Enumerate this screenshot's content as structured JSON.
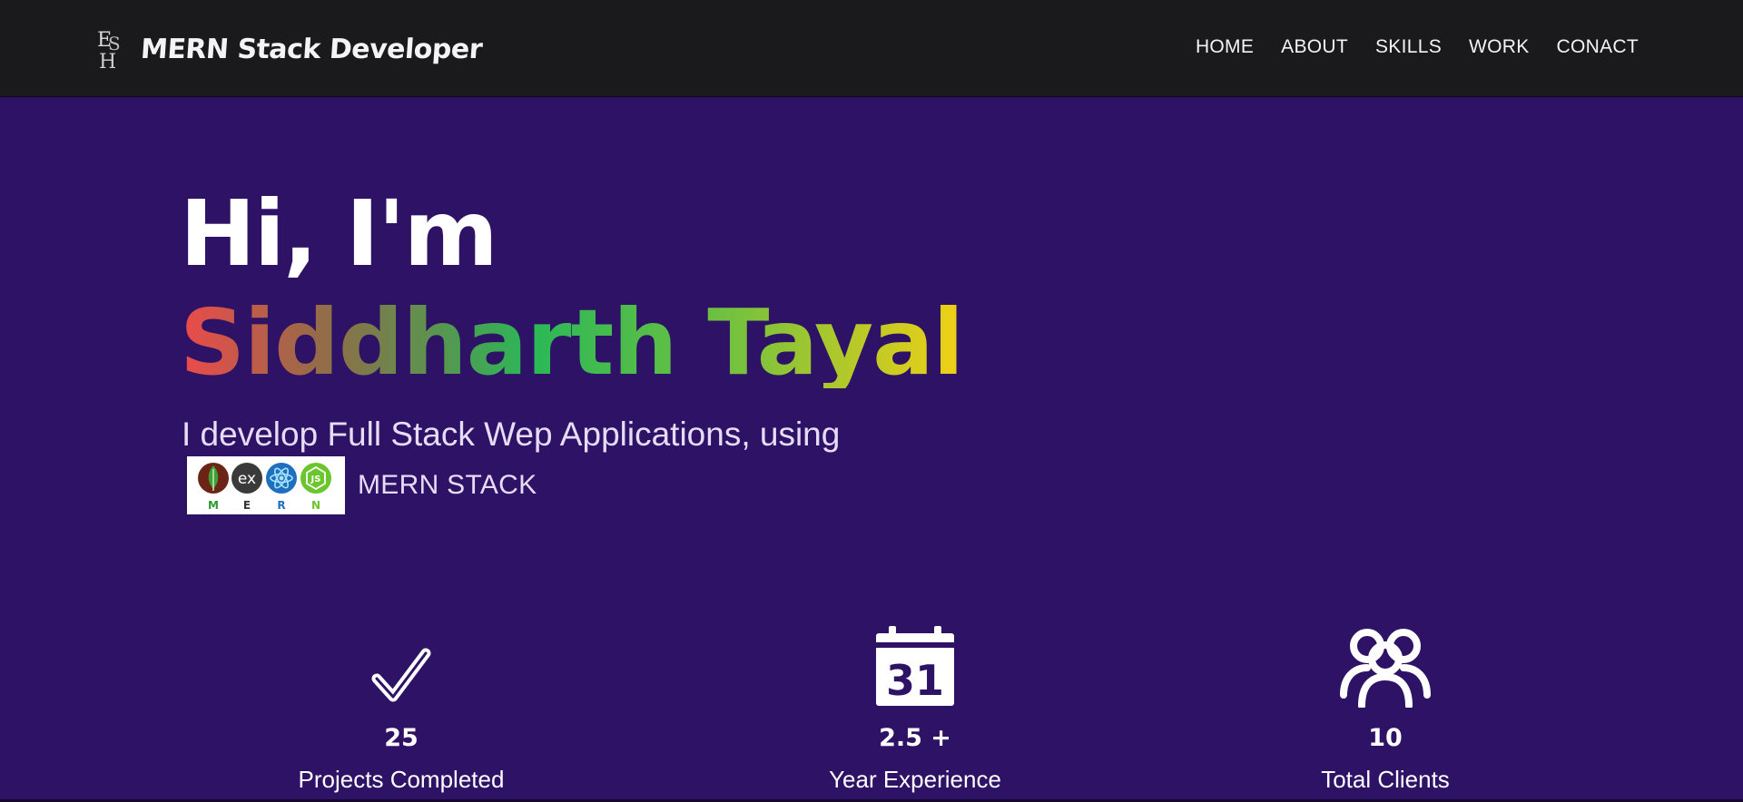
{
  "header": {
    "brand_title": "MERN Stack Developer",
    "nav": [
      "HOME",
      "ABOUT",
      "SKILLS",
      "WORK",
      "CONACT"
    ]
  },
  "hero": {
    "greeting": "Hi, I'm",
    "name": "Siddharth Tayal",
    "tagline": "I develop Full Stack Wep Applications, using",
    "stack_label": "MERN STACK",
    "stack_logo_letters": [
      "M",
      "E",
      "R",
      "N"
    ],
    "stack_logo_badges": [
      "mongodb-leaf",
      "ex",
      "react-atom",
      "js"
    ]
  },
  "stats": [
    {
      "icon": "checkmark-icon",
      "value": "25",
      "label": "Projects Completed"
    },
    {
      "icon": "calendar-icon",
      "value": "2.5 +",
      "label": "Year Experience",
      "calendar_day": "31"
    },
    {
      "icon": "users-icon",
      "value": "10",
      "label": "Total Clients"
    }
  ],
  "colors": {
    "header_bg": "#1a1a1c",
    "hero_bg": "#2e1266",
    "name_gradient": [
      "#ec4a4a",
      "#2ab857",
      "#f2d015"
    ]
  }
}
